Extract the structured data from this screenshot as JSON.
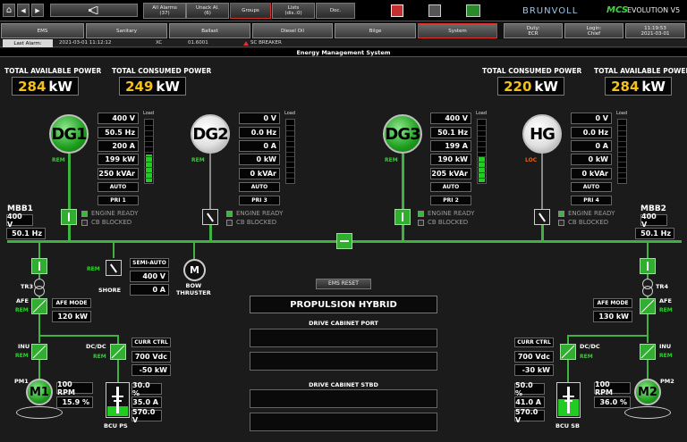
{
  "topbar": {
    "home_label": "⌂",
    "back_label": "◀",
    "fwd_label": "▶",
    "alarm_all": "All Alarms\n(37)",
    "alarm_unack": "Unack Al.\n(6)",
    "groups": "Groups",
    "lists": "Lists\n(dis.:0)",
    "doc": "Doc.",
    "brand": "BRUNVOLL",
    "mcs": "MCS",
    "product": "EVOLUTION V5"
  },
  "navbar": {
    "items": [
      "EMS",
      "Sanitary",
      "Ballast",
      "Diesel Oil",
      "Bilge",
      "System"
    ],
    "duty": "Duty:\nECR",
    "login": "Login:\nChief",
    "time": "11:19:53\n2021-03-01"
  },
  "alarmbar": {
    "label": "Last Alarm:",
    "time": "2021-03-01 11:12:12",
    "tag": "XC",
    "code": "01.6001",
    "text": "SC BREAKER"
  },
  "title": "Energy Management System",
  "power": {
    "left_avail_label": "TOTAL AVAILABLE POWER",
    "left_avail": "284",
    "left_cons_label": "TOTAL CONSUMED POWER",
    "left_cons": "249",
    "right_cons_label": "TOTAL CONSUMED POWER",
    "right_cons": "220",
    "right_avail_label": "TOTAL AVAILABLE POWER",
    "right_avail": "284",
    "unit": "kW"
  },
  "gens": [
    {
      "name": "DG1",
      "state": "REM",
      "load_label": "Load",
      "load": 0.45,
      "v": "400 V",
      "hz": "50.5 Hz",
      "a": "200 A",
      "kw": "199 kW",
      "kvar": "250 kVAr",
      "mode": "AUTO",
      "pri": "PRI 1",
      "ready": "ENGINE READY",
      "blocked": "CB BLOCKED"
    },
    {
      "name": "DG2",
      "state": "REM",
      "load_label": "Load",
      "load": 0,
      "v": "0 V",
      "hz": "0.0 Hz",
      "a": "0 A",
      "kw": "0 kW",
      "kvar": "0 kVAr",
      "mode": "AUTO",
      "pri": "PRI 3",
      "ready": "ENGINE READY",
      "blocked": "CB BLOCKED"
    },
    {
      "name": "DG3",
      "state": "REM",
      "load_label": "Load",
      "load": 0.42,
      "v": "400 V",
      "hz": "50.1 Hz",
      "a": "199 A",
      "kw": "190 kW",
      "kvar": "205 kVAr",
      "mode": "AUTO",
      "pri": "PRI 2",
      "ready": "ENGINE READY",
      "blocked": "CB BLOCKED"
    },
    {
      "name": "HG",
      "state": "LOC",
      "load_label": "Load",
      "load": 0,
      "v": "0 V",
      "hz": "0.0 Hz",
      "a": "0 A",
      "kw": "0 kW",
      "kvar": "0 kVAr",
      "mode": "AUTO",
      "pri": "PRI 4",
      "ready": "ENGINE READY",
      "blocked": "CB BLOCKED"
    }
  ],
  "mbb1": {
    "label": "MBB1",
    "v": "400 V",
    "hz": "50.1 Hz"
  },
  "mbb2": {
    "label": "MBB2",
    "v": "400 V",
    "hz": "50.1 Hz"
  },
  "shore": {
    "label": "SHORE",
    "state": "REM",
    "mode": "SEMI-AUTO",
    "v": "400 V",
    "a": "0 A"
  },
  "bow": {
    "label": "BOW\nTHRUSTER",
    "letter": "M"
  },
  "ems_reset": "EMS RESET",
  "prop_title": "PROPULSION HYBRID",
  "drive_port": "DRIVE CABINET PORT",
  "drive_stbd": "DRIVE CABINET STBD",
  "port": {
    "tr": "TR3",
    "afe": "AFE",
    "afe_state": "REM",
    "afe_mode": "AFE MODE",
    "afe_kw": "120 kW",
    "inu": "INU",
    "inu_state": "REM",
    "dcdc": "DC/DC",
    "dcdc_state": "REM",
    "curr": "CURR CTRL",
    "vdc": "700 Vdc",
    "dckw": "-50 kW",
    "pm": "PM1",
    "motor": "M1",
    "rpm": "100 RPM",
    "pct": "15.9 %",
    "soc": "30.0 %",
    "bat_a": "35.0 A",
    "bat_v": "570.0 V",
    "bcu": "BCU PS"
  },
  "stbd": {
    "tr": "TR4",
    "afe": "AFE",
    "afe_state": "REM",
    "afe_mode": "AFE MODE",
    "afe_kw": "130 kW",
    "inu": "INU",
    "inu_state": "REM",
    "dcdc": "DC/DC",
    "dcdc_state": "REM",
    "curr": "CURR CTRL",
    "vdc": "700 Vdc",
    "dckw": "-30 kW",
    "pm": "PM2",
    "motor": "M2",
    "rpm": "100 RPM",
    "pct": "36.0 %",
    "soc": "50.0 %",
    "bat_a": "41.0 A",
    "bat_v": "570.0 V",
    "bcu": "BCU SB"
  }
}
